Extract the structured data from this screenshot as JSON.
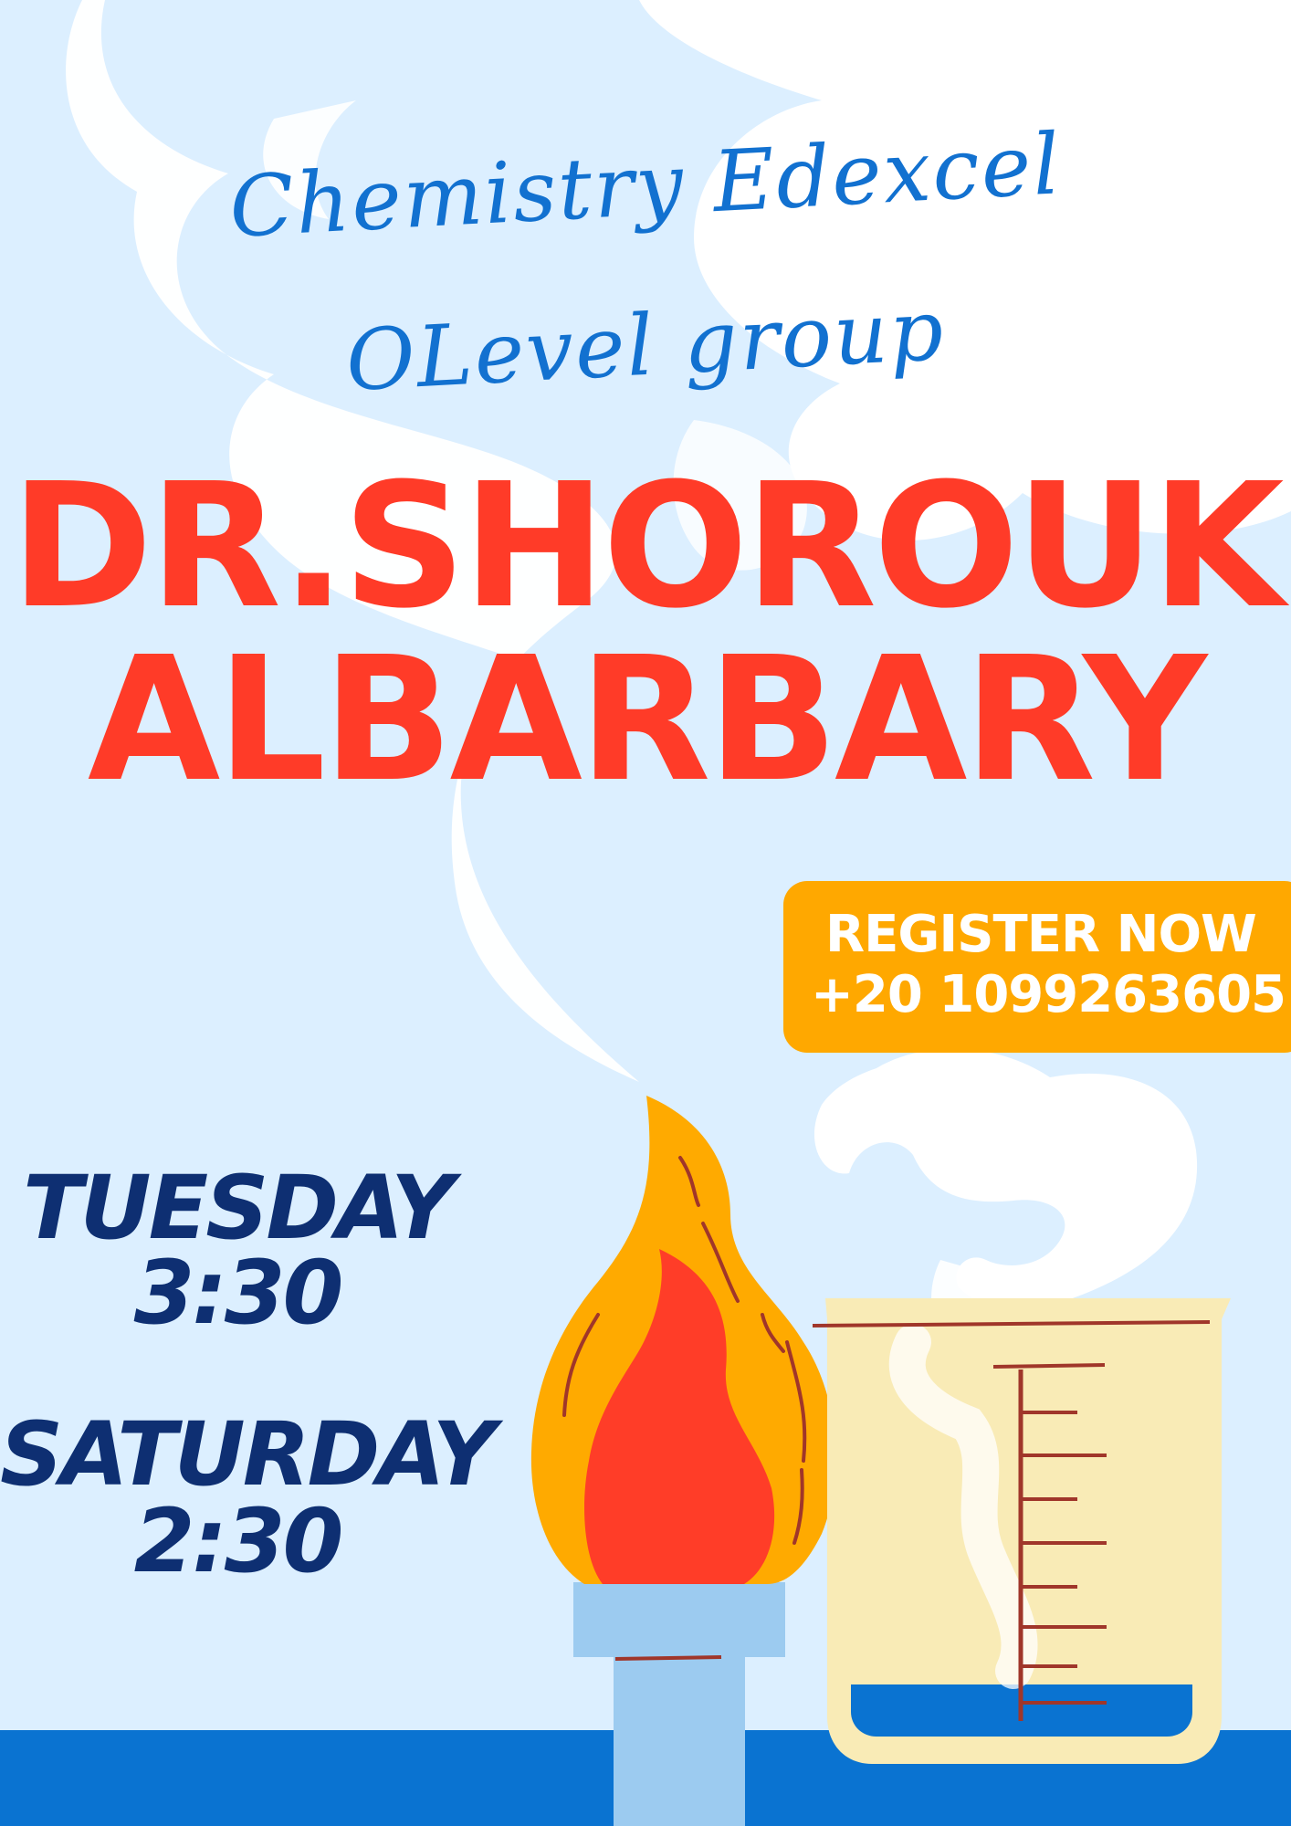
{
  "heading": {
    "script_line_1": "Chemistry Edexcel",
    "script_line_2": "OLevel group"
  },
  "teacher": {
    "line_1": "DR.SHOROUK",
    "line_2": "ALBARBARY"
  },
  "register": {
    "title": "REGISTER NOW",
    "phone": "+20 1099263605"
  },
  "schedule": [
    {
      "day": "TUESDAY",
      "time": "3:30"
    },
    {
      "day": "SATURDAY",
      "time": "2:30"
    }
  ],
  "colors": {
    "background": "#dcefff",
    "script_blue": "#1271d0",
    "name_red": "#ff3b28",
    "register_orange": "#ffa800",
    "schedule_navy": "#0e2f72",
    "floor_blue": "#0a73d1"
  },
  "icons": [
    "bunsen-burner-flame-icon",
    "beaker-icon",
    "steam-smoke-icon"
  ]
}
